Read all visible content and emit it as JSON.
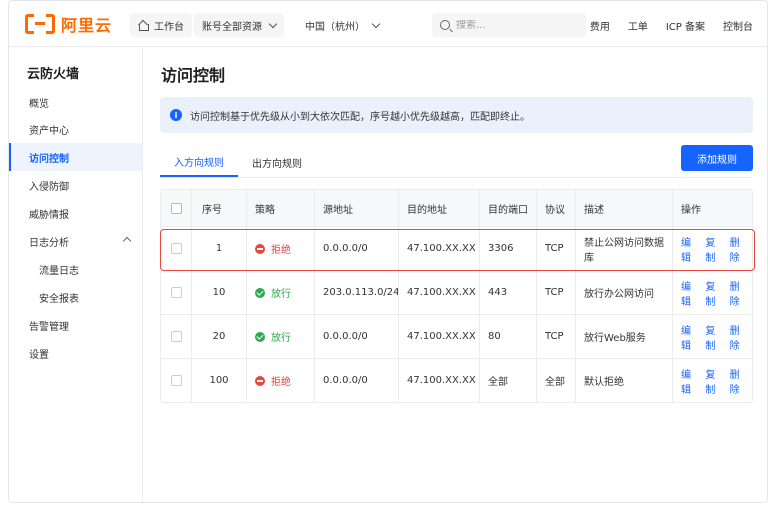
{
  "brand": {
    "name": "阿里云",
    "accent": "#ff6a00"
  },
  "topbar": {
    "workbench": "工作台",
    "account_scope": "账号全部资源",
    "region": "中国（杭州）",
    "search_placeholder": "搜索...",
    "links": [
      "费用",
      "工单",
      "ICP 备案",
      "控制台"
    ]
  },
  "sidebar": {
    "title": "云防火墙",
    "items": [
      {
        "label": "概览",
        "sub": false,
        "active": false
      },
      {
        "label": "资产中心",
        "sub": false,
        "active": false
      },
      {
        "label": "访问控制",
        "sub": false,
        "active": true
      },
      {
        "label": "入侵防御",
        "sub": false,
        "active": false
      },
      {
        "label": "威胁情报",
        "sub": false,
        "active": false
      },
      {
        "label": "日志分析",
        "sub": false,
        "active": false,
        "expanded": true
      },
      {
        "label": "流量日志",
        "sub": true,
        "active": false
      },
      {
        "label": "安全报表",
        "sub": true,
        "active": false
      },
      {
        "label": "告警管理",
        "sub": false,
        "active": false
      },
      {
        "label": "设置",
        "sub": false,
        "active": false
      }
    ]
  },
  "main": {
    "title": "访问控制",
    "notice": "访问控制基于优先级从小到大依次匹配，序号越小优先级越高，匹配即终止。",
    "tabs": [
      {
        "label": "入方向规则",
        "active": true
      },
      {
        "label": "出方向规则",
        "active": false
      }
    ],
    "add_button": "添加规则"
  },
  "table": {
    "headers": [
      "序号",
      "策略",
      "源地址",
      "目的地址",
      "目的端口",
      "协议",
      "描述",
      "操作"
    ],
    "actions": [
      "编辑",
      "复制",
      "删除"
    ],
    "rows": [
      {
        "priority": "1",
        "policy": "拒绝",
        "policy_type": "deny",
        "source": "0.0.0.0/0",
        "destination": "47.100.XX.XX",
        "port": "3306",
        "protocol": "TCP",
        "description": "禁止公网访问数据库",
        "highlighted": true
      },
      {
        "priority": "10",
        "policy": "放行",
        "policy_type": "allow",
        "source": "203.0.113.0/24",
        "destination": "47.100.XX.XX",
        "port": "443",
        "protocol": "TCP",
        "description": "放行办公网访问",
        "highlighted": false
      },
      {
        "priority": "20",
        "policy": "放行",
        "policy_type": "allow",
        "source": "0.0.0.0/0",
        "destination": "47.100.XX.XX",
        "port": "80",
        "protocol": "TCP",
        "description": "放行Web服务",
        "highlighted": false
      },
      {
        "priority": "100",
        "policy": "拒绝",
        "policy_type": "deny",
        "source": "0.0.0.0/0",
        "destination": "47.100.XX.XX",
        "port": "全部",
        "protocol": "全部",
        "description": "默认拒绝",
        "highlighted": false
      }
    ]
  },
  "colors": {
    "primary": "#1664ff",
    "deny": "#e8453c",
    "allow": "#2fa84f",
    "highlight_border": "#e8453c"
  }
}
